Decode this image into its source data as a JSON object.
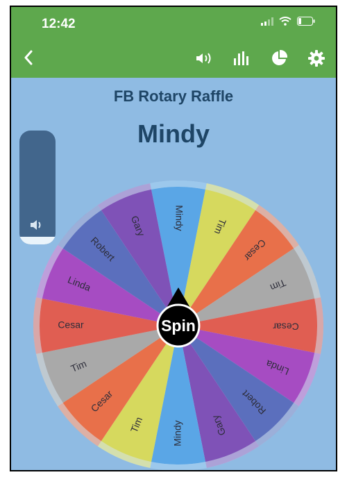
{
  "status_bar": {
    "time": "12:42"
  },
  "header": {
    "back_icon": "chevron-left-icon",
    "tools": [
      "speaker-icon",
      "bar-chart-icon",
      "pie-chart-icon",
      "gear-icon"
    ]
  },
  "wheel": {
    "title": "FB Rotary Raffle",
    "result": "Mindy",
    "spin_label": "Spin",
    "segments": [
      {
        "label": "Mindy",
        "color": "#5aa6e6"
      },
      {
        "label": "Tim",
        "color": "#d6d95e"
      },
      {
        "label": "Cesar",
        "color": "#e8704a"
      },
      {
        "label": "Tim",
        "color": "#a9a9a9"
      },
      {
        "label": "Cesar",
        "color": "#e05e52"
      },
      {
        "label": "Linda",
        "color": "#a64cc2"
      },
      {
        "label": "Robert",
        "color": "#5b6fbd"
      },
      {
        "label": "Gary",
        "color": "#7f52b7"
      },
      {
        "label": "Mindy",
        "color": "#5aa6e6"
      },
      {
        "label": "Tim",
        "color": "#d6d95e"
      },
      {
        "label": "Cesar",
        "color": "#e8704a"
      },
      {
        "label": "Tim",
        "color": "#a9a9a9"
      },
      {
        "label": "Cesar",
        "color": "#e05e52"
      },
      {
        "label": "Linda",
        "color": "#a64cc2"
      },
      {
        "label": "Robert",
        "color": "#5b6fbd"
      },
      {
        "label": "Gary",
        "color": "#7f52b7"
      }
    ]
  },
  "colors": {
    "header_green": "#5ea84d",
    "background_blue": "#8fbbe3",
    "title_navy": "#1e4566"
  }
}
